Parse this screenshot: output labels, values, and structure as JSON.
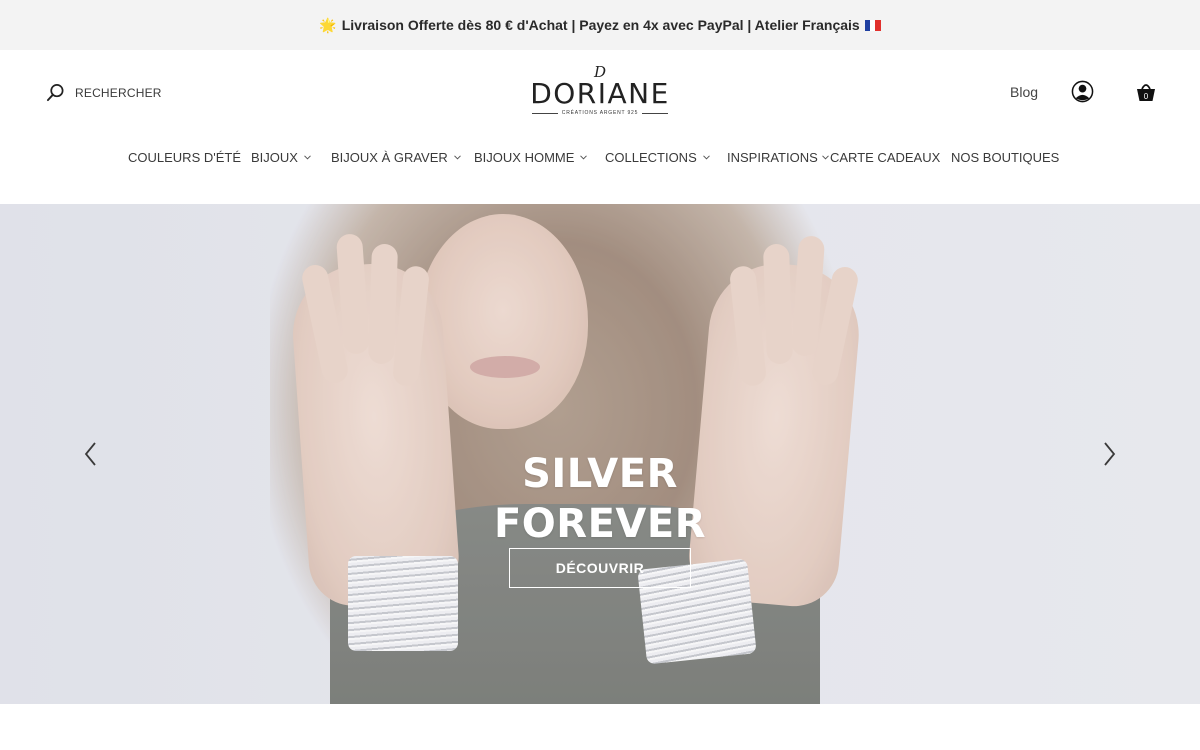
{
  "announcement": {
    "text": "Livraison Offerte dès 80 € d'Achat | Payez en 4x avec PayPal | Atelier Français",
    "sun_emoji": "🌟",
    "flag_colors": [
      "#1f3fa0",
      "#ffffff",
      "#e1302d"
    ]
  },
  "header": {
    "search_label": "RECHERCHER",
    "search_icon": "search-icon",
    "logo": {
      "monogram": "D",
      "name": "DORIANE",
      "tagline": "CRÉATIONS ARGENT 925"
    },
    "blog_label": "Blog",
    "account_icon": "account-icon",
    "cart_icon": "basket-icon",
    "cart_count": "0"
  },
  "nav": {
    "items": [
      {
        "label": "COULEURS D'ÉTÉ",
        "has_dropdown": false
      },
      {
        "label": "BIJOUX",
        "has_dropdown": true
      },
      {
        "label": "BIJOUX À GRAVER",
        "has_dropdown": true
      },
      {
        "label": "BIJOUX HOMME",
        "has_dropdown": true
      },
      {
        "label": "COLLECTIONS",
        "has_dropdown": true
      },
      {
        "label": "INSPIRATIONS",
        "has_dropdown": true
      },
      {
        "label": "CARTE CADEAUX",
        "has_dropdown": false
      },
      {
        "label": "NOS BOUTIQUES",
        "has_dropdown": false
      }
    ]
  },
  "hero": {
    "title_line1": "SILVER",
    "title_line2": "FOREVER",
    "cta_label": "DÉCOUVRIR",
    "prev_icon": "chevron-left-icon",
    "next_icon": "chevron-right-icon"
  },
  "colors": {
    "announce_bg": "#f3f3f3",
    "text": "#333333",
    "hero_bg": "#dfe0e8"
  }
}
